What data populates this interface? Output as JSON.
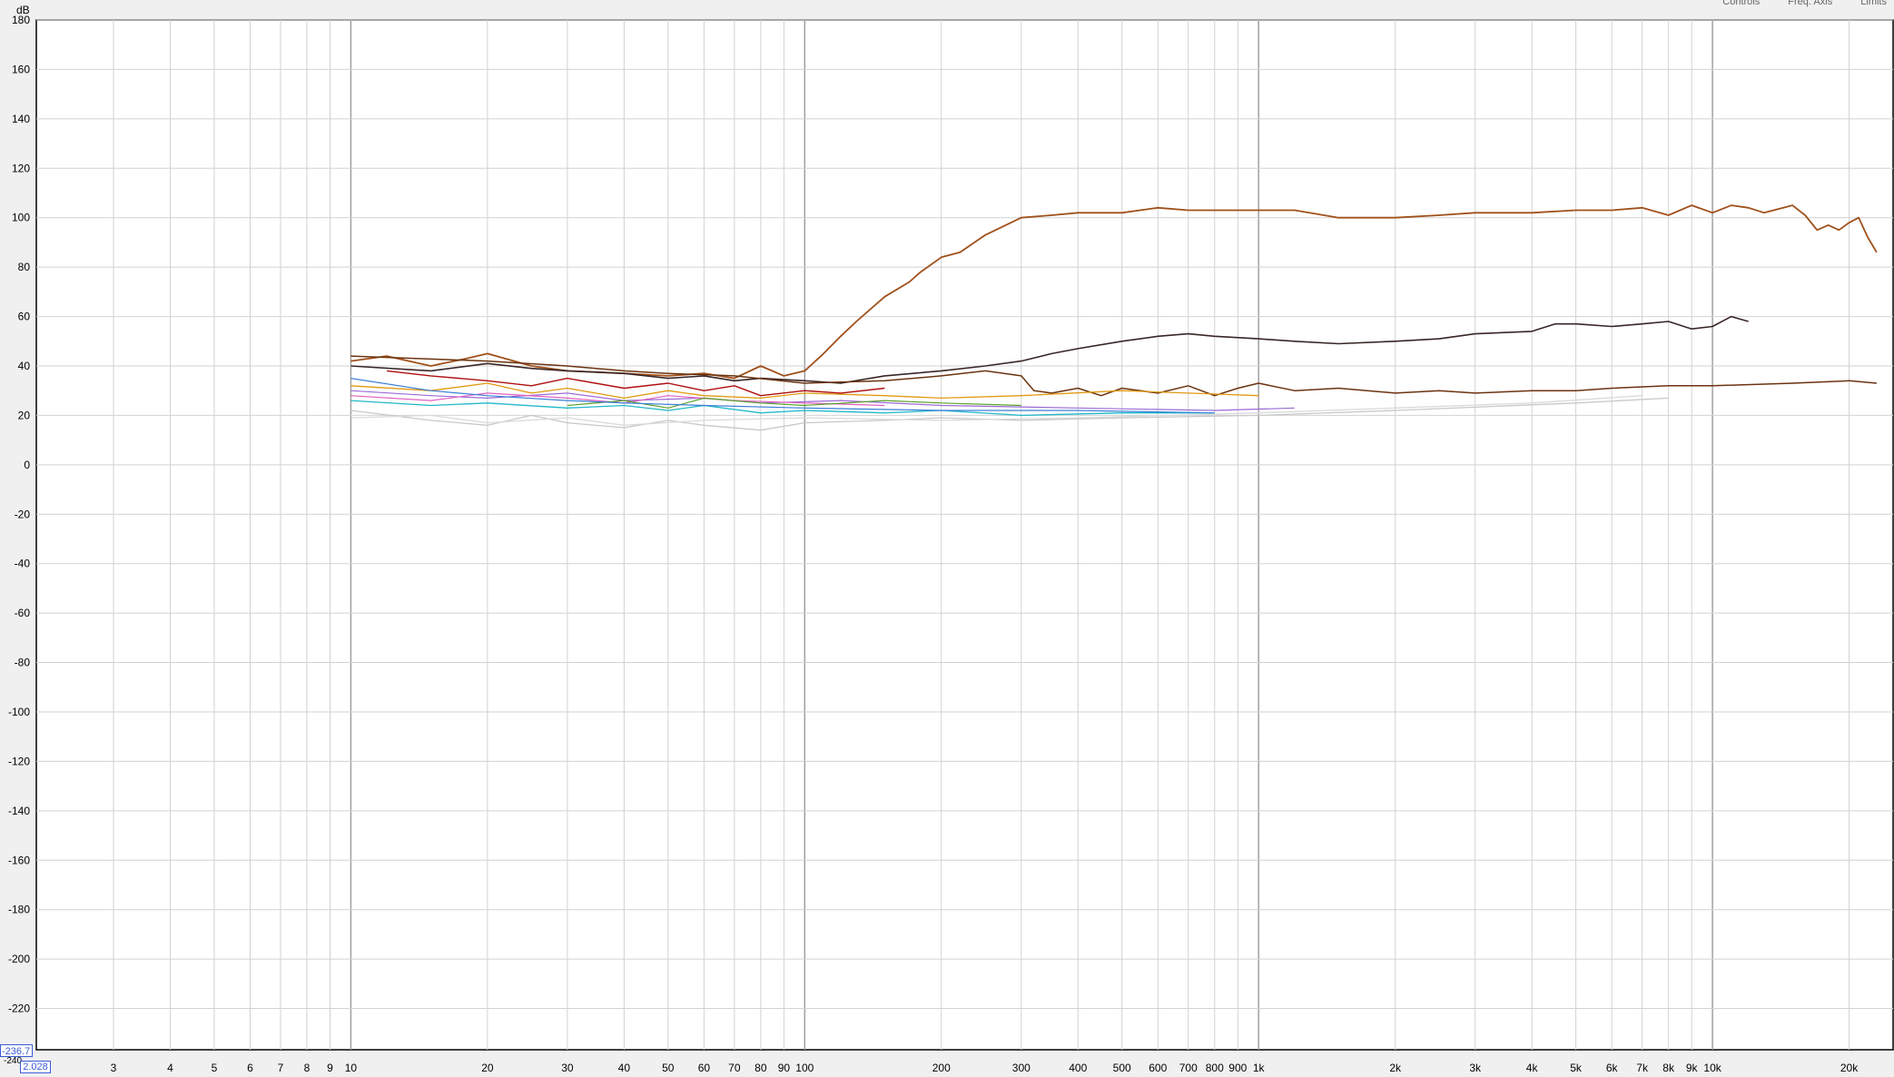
{
  "window": {
    "top_controls": [
      "Controls",
      "Freq. Axis",
      "Limits"
    ]
  },
  "cursor": {
    "y_readout": "-236.7",
    "x_readout": "2.028",
    "y_clip_label": "-240"
  },
  "chart_data": {
    "type": "line",
    "title": "",
    "xlabel": "",
    "ylabel": "dB",
    "x_scale": "log",
    "xlim": [
      2.028,
      25000
    ],
    "ylim": [
      -236.7,
      180
    ],
    "grid": true,
    "y_ticks": [
      180,
      160,
      140,
      120,
      100,
      80,
      60,
      40,
      20,
      0,
      -20,
      -40,
      -60,
      -80,
      -100,
      -120,
      -140,
      -160,
      -180,
      -200,
      -220
    ],
    "x_ticks": [
      {
        "v": 3,
        "label": "3"
      },
      {
        "v": 4,
        "label": "4"
      },
      {
        "v": 5,
        "label": "5"
      },
      {
        "v": 6,
        "label": "6"
      },
      {
        "v": 7,
        "label": "7"
      },
      {
        "v": 8,
        "label": "8"
      },
      {
        "v": 9,
        "label": "9"
      },
      {
        "v": 10,
        "label": "10"
      },
      {
        "v": 20,
        "label": "20"
      },
      {
        "v": 30,
        "label": "30"
      },
      {
        "v": 40,
        "label": "40"
      },
      {
        "v": 50,
        "label": "50"
      },
      {
        "v": 60,
        "label": "60"
      },
      {
        "v": 70,
        "label": "70"
      },
      {
        "v": 80,
        "label": "80"
      },
      {
        "v": 90,
        "label": "90"
      },
      {
        "v": 100,
        "label": "100"
      },
      {
        "v": 200,
        "label": "200"
      },
      {
        "v": 300,
        "label": "300"
      },
      {
        "v": 400,
        "label": "400"
      },
      {
        "v": 500,
        "label": "500"
      },
      {
        "v": 600,
        "label": "600"
      },
      {
        "v": 700,
        "label": "700"
      },
      {
        "v": 800,
        "label": "800"
      },
      {
        "v": 900,
        "label": "900"
      },
      {
        "v": 1000,
        "label": "1k"
      },
      {
        "v": 2000,
        "label": "2k"
      },
      {
        "v": 3000,
        "label": "3k"
      },
      {
        "v": 4000,
        "label": "4k"
      },
      {
        "v": 5000,
        "label": "5k"
      },
      {
        "v": 6000,
        "label": "6k"
      },
      {
        "v": 7000,
        "label": "7k"
      },
      {
        "v": 8000,
        "label": "8k"
      },
      {
        "v": 9000,
        "label": "9k"
      },
      {
        "v": 10000,
        "label": "10k"
      },
      {
        "v": 20000,
        "label": "20k"
      }
    ],
    "series": [
      {
        "color": "#a0501a",
        "width": 1.8,
        "x": [
          10,
          12,
          15,
          18,
          20,
          25,
          30,
          40,
          50,
          60,
          70,
          80,
          90,
          100,
          110,
          120,
          130,
          150,
          170,
          180,
          200,
          220,
          250,
          300,
          350,
          400,
          500,
          600,
          700,
          800,
          1000,
          1200,
          1500,
          2000,
          2500,
          3000,
          4000,
          5000,
          6000,
          7000,
          8000,
          9000,
          10000,
          11000,
          12000,
          13000,
          15000,
          16000,
          17000,
          18000,
          19000,
          20000,
          21000,
          22000,
          23000
        ],
        "values": [
          42,
          44,
          40,
          43,
          45,
          40,
          38,
          37,
          36,
          37,
          35,
          40,
          36,
          38,
          45,
          52,
          58,
          68,
          74,
          78,
          84,
          86,
          93,
          100,
          101,
          102,
          102,
          104,
          103,
          103,
          103,
          103,
          100,
          100,
          101,
          102,
          102,
          103,
          103,
          104,
          101,
          105,
          102,
          105,
          104,
          102,
          105,
          101,
          95,
          97,
          95,
          98,
          100,
          92,
          86
        ]
      },
      {
        "color": "#3a2626",
        "width": 1.6,
        "x": [
          10,
          15,
          20,
          25,
          30,
          40,
          50,
          60,
          70,
          80,
          100,
          120,
          150,
          200,
          250,
          300,
          350,
          400,
          500,
          600,
          700,
          800,
          1000,
          1200,
          1500,
          2000,
          2500,
          3000,
          4000,
          4500,
          5000,
          6000,
          7000,
          8000,
          9000,
          10000,
          11000,
          12000
        ],
        "values": [
          40,
          38,
          41,
          39,
          38,
          37,
          35,
          36,
          34,
          35,
          34,
          33,
          36,
          38,
          40,
          42,
          45,
          47,
          50,
          52,
          53,
          52,
          51,
          50,
          49,
          50,
          51,
          53,
          54,
          57,
          57,
          56,
          57,
          58,
          55,
          56,
          60,
          58
        ]
      },
      {
        "color": "#6b3310",
        "width": 1.5,
        "x": [
          10,
          20,
          30,
          40,
          50,
          70,
          100,
          150,
          200,
          250,
          300,
          320,
          350,
          400,
          450,
          500,
          600,
          700,
          800,
          900,
          1000,
          1200,
          1500,
          2000,
          2500,
          3000,
          4000,
          5000,
          6000,
          8000,
          10000,
          15000,
          20000,
          23000
        ],
        "values": [
          44,
          42,
          40,
          38,
          37,
          36,
          33,
          34,
          36,
          38,
          36,
          30,
          29,
          31,
          28,
          31,
          29,
          32,
          28,
          31,
          33,
          30,
          31,
          29,
          30,
          29,
          30,
          30,
          31,
          32,
          32,
          33,
          34,
          33
        ]
      },
      {
        "color": "#b01010",
        "width": 1.4,
        "x": [
          12,
          15,
          20,
          25,
          30,
          40,
          50,
          60,
          70,
          80,
          100,
          120,
          150
        ],
        "values": [
          38,
          36,
          34,
          32,
          35,
          31,
          33,
          30,
          32,
          28,
          30,
          29,
          31
        ]
      },
      {
        "color": "#e09a10",
        "width": 1.3,
        "x": [
          10,
          15,
          20,
          25,
          30,
          40,
          50,
          60,
          80,
          100,
          150,
          200,
          300,
          500,
          700,
          1000
        ],
        "values": [
          32,
          30,
          33,
          29,
          31,
          27,
          30,
          28,
          27,
          29,
          28,
          27,
          28,
          30,
          29,
          28
        ]
      },
      {
        "color": "#9c6bd6",
        "width": 1.2,
        "x": [
          10,
          15,
          20,
          30,
          40,
          60,
          80,
          120,
          200,
          400,
          800,
          1200
        ],
        "values": [
          30,
          28,
          27,
          29,
          26,
          27,
          25,
          26,
          24,
          23,
          22,
          23
        ]
      },
      {
        "color": "#e060c0",
        "width": 1.2,
        "x": [
          10,
          15,
          20,
          30,
          40,
          50,
          70,
          100,
          150
        ],
        "values": [
          28,
          26,
          29,
          27,
          25,
          28,
          26,
          25,
          24
        ]
      },
      {
        "color": "#5aa02a",
        "width": 1.2,
        "x": [
          30,
          40,
          50,
          60,
          80,
          100,
          150,
          200,
          300
        ],
        "values": [
          24,
          26,
          23,
          27,
          25,
          24,
          26,
          25,
          24
        ]
      },
      {
        "color": "#20b8c8",
        "width": 1.3,
        "x": [
          10,
          15,
          20,
          30,
          40,
          50,
          60,
          80,
          100,
          150,
          200,
          300,
          500,
          800
        ],
        "values": [
          26,
          24,
          25,
          23,
          24,
          22,
          24,
          21,
          22,
          21,
          22,
          20,
          21,
          21
        ]
      },
      {
        "color": "#3a7fd8",
        "width": 1.2,
        "x": [
          10,
          15,
          20,
          30,
          40,
          60,
          100,
          200,
          400,
          800
        ],
        "values": [
          35,
          30,
          28,
          26,
          25,
          24,
          23,
          22,
          22,
          21
        ]
      },
      {
        "color": "#c8c8c8",
        "width": 1.3,
        "x": [
          10,
          15,
          20,
          25,
          30,
          40,
          50,
          60,
          80,
          100,
          150,
          200,
          300,
          500,
          1000,
          2000,
          5000,
          8000
        ],
        "values": [
          22,
          18,
          16,
          20,
          17,
          15,
          18,
          16,
          14,
          17,
          18,
          19,
          18,
          19,
          20,
          22,
          25,
          27
        ]
      },
      {
        "color": "#dadada",
        "width": 1.3,
        "x": [
          10,
          15,
          20,
          30,
          40,
          60,
          100,
          200,
          400,
          1000,
          2000,
          4000,
          7000
        ],
        "values": [
          19,
          20,
          17,
          19,
          16,
          18,
          19,
          18,
          19,
          21,
          23,
          25,
          28
        ]
      }
    ]
  }
}
